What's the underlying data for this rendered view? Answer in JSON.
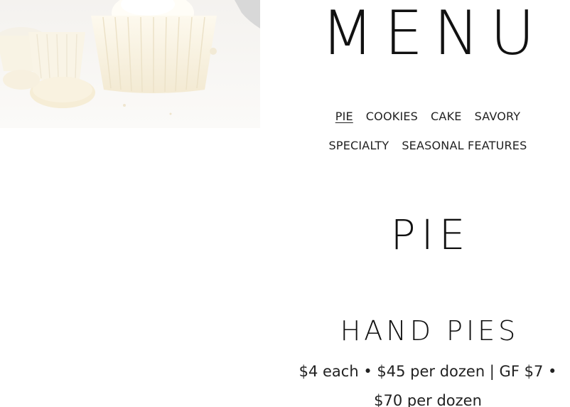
{
  "hero": {
    "image_alt": "white cupcakes with frosting"
  },
  "menu": {
    "title": "MENU",
    "nav_row1": [
      {
        "label": "PIE",
        "active": true
      },
      {
        "label": "COOKIES",
        "active": false
      },
      {
        "label": "CAKE",
        "active": false
      },
      {
        "label": "SAVORY",
        "active": false
      }
    ],
    "nav_row2": [
      {
        "label": "SPECIALTY",
        "active": false
      },
      {
        "label": "SEASONAL FEATURES",
        "active": false
      }
    ]
  },
  "section": {
    "title": "PIE",
    "item": {
      "name": "HAND PIES",
      "price": "$4 each • $45 per dozen | GF $7 • $70 per dozen"
    }
  }
}
